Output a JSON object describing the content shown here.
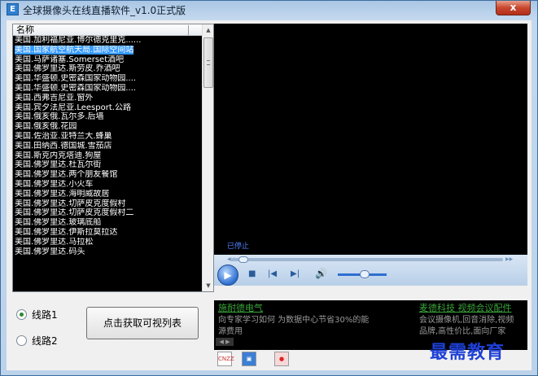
{
  "window": {
    "title": "全球摄像头在线直播软件_v1.0正式版",
    "icon_label": "E",
    "close_label": "x"
  },
  "list": {
    "header": "名称",
    "selected_index": 1,
    "items": [
      "美国.加利福尼亚.博尔德克里克......",
      "美国.国家航空航天局.国际空间站",
      "美国.马萨诸塞.Somerset酒吧",
      "美国.佛罗里达.斯劳皮.乔酒吧",
      "美国.华盛顿.史密森国家动物园....",
      "美国.华盛顿.史密森国家动物园....",
      "美国.西弗吉尼亚.窗外",
      "美国.宾夕法尼亚.Leesport.公路",
      "美国.俄亥俄.瓦尔多.后墙",
      "美国.俄亥俄.花园",
      "美国.佐治亚.亚特兰大.蜂巢",
      "美国.田纳西.德国城.雪茄店",
      "美国.斯克内克塔迪.狗屋",
      "美国.佛罗里达.杜瓦尔街",
      "美国.佛罗里达.两个朋友餐馆",
      "美国.佛罗里达.小火车",
      "美国.佛罗里达.海明威故居",
      "美国.佛罗里达.切萨皮克度假村",
      "美国.佛罗里达.切萨皮克度假村二",
      "美国.佛罗里达.玻璃底船",
      "美国.佛罗里达.伊斯拉莫拉达",
      "美国.佛罗里达.马拉松",
      "美国.佛罗里达.码头"
    ]
  },
  "video": {
    "status": "已停止",
    "seek_progress": 0.03,
    "volume": 0.55
  },
  "routes": {
    "route1": "线路1",
    "route2": "线路2",
    "selected": "route1"
  },
  "fetch_button": "点击获取可视列表",
  "ads": {
    "left_title": "施耐德电气",
    "left_line1": "向专家学习如何 为数据中心节省30%的能",
    "left_line2": "源费用",
    "right_title": "麦德科技 视频会议配件",
    "right_line1": "会议摄像机,回音消除,视频",
    "right_line2": "品牌,高性价比,面向厂家",
    "icon1": "CNZZ"
  },
  "watermark": "最需教育",
  "colors": {
    "selection": "#3399ff",
    "ad_link": "#3ca53c",
    "status_text": "#4f82ff"
  }
}
